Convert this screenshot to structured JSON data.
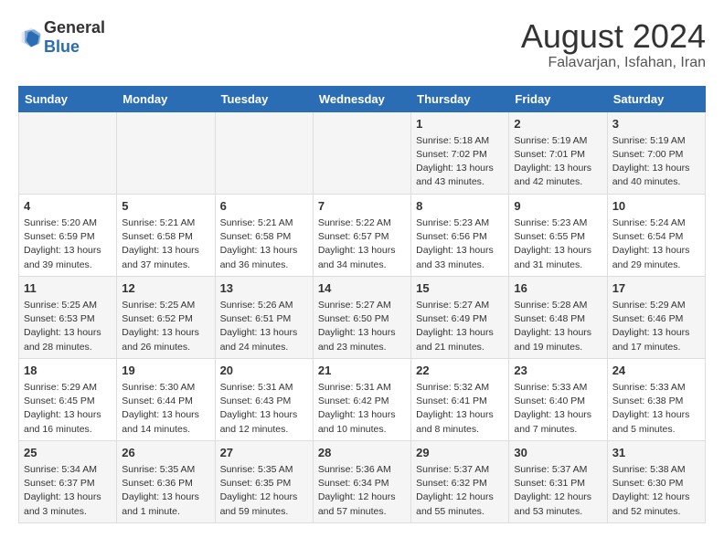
{
  "header": {
    "logo_general": "General",
    "logo_blue": "Blue",
    "title": "August 2024",
    "subtitle": "Falavarjan, Isfahan, Iran"
  },
  "weekdays": [
    "Sunday",
    "Monday",
    "Tuesday",
    "Wednesday",
    "Thursday",
    "Friday",
    "Saturday"
  ],
  "weeks": [
    [
      {
        "day": "",
        "info": ""
      },
      {
        "day": "",
        "info": ""
      },
      {
        "day": "",
        "info": ""
      },
      {
        "day": "",
        "info": ""
      },
      {
        "day": "1",
        "info": "Sunrise: 5:18 AM\nSunset: 7:02 PM\nDaylight: 13 hours\nand 43 minutes."
      },
      {
        "day": "2",
        "info": "Sunrise: 5:19 AM\nSunset: 7:01 PM\nDaylight: 13 hours\nand 42 minutes."
      },
      {
        "day": "3",
        "info": "Sunrise: 5:19 AM\nSunset: 7:00 PM\nDaylight: 13 hours\nand 40 minutes."
      }
    ],
    [
      {
        "day": "4",
        "info": "Sunrise: 5:20 AM\nSunset: 6:59 PM\nDaylight: 13 hours\nand 39 minutes."
      },
      {
        "day": "5",
        "info": "Sunrise: 5:21 AM\nSunset: 6:58 PM\nDaylight: 13 hours\nand 37 minutes."
      },
      {
        "day": "6",
        "info": "Sunrise: 5:21 AM\nSunset: 6:58 PM\nDaylight: 13 hours\nand 36 minutes."
      },
      {
        "day": "7",
        "info": "Sunrise: 5:22 AM\nSunset: 6:57 PM\nDaylight: 13 hours\nand 34 minutes."
      },
      {
        "day": "8",
        "info": "Sunrise: 5:23 AM\nSunset: 6:56 PM\nDaylight: 13 hours\nand 33 minutes."
      },
      {
        "day": "9",
        "info": "Sunrise: 5:23 AM\nSunset: 6:55 PM\nDaylight: 13 hours\nand 31 minutes."
      },
      {
        "day": "10",
        "info": "Sunrise: 5:24 AM\nSunset: 6:54 PM\nDaylight: 13 hours\nand 29 minutes."
      }
    ],
    [
      {
        "day": "11",
        "info": "Sunrise: 5:25 AM\nSunset: 6:53 PM\nDaylight: 13 hours\nand 28 minutes."
      },
      {
        "day": "12",
        "info": "Sunrise: 5:25 AM\nSunset: 6:52 PM\nDaylight: 13 hours\nand 26 minutes."
      },
      {
        "day": "13",
        "info": "Sunrise: 5:26 AM\nSunset: 6:51 PM\nDaylight: 13 hours\nand 24 minutes."
      },
      {
        "day": "14",
        "info": "Sunrise: 5:27 AM\nSunset: 6:50 PM\nDaylight: 13 hours\nand 23 minutes."
      },
      {
        "day": "15",
        "info": "Sunrise: 5:27 AM\nSunset: 6:49 PM\nDaylight: 13 hours\nand 21 minutes."
      },
      {
        "day": "16",
        "info": "Sunrise: 5:28 AM\nSunset: 6:48 PM\nDaylight: 13 hours\nand 19 minutes."
      },
      {
        "day": "17",
        "info": "Sunrise: 5:29 AM\nSunset: 6:46 PM\nDaylight: 13 hours\nand 17 minutes."
      }
    ],
    [
      {
        "day": "18",
        "info": "Sunrise: 5:29 AM\nSunset: 6:45 PM\nDaylight: 13 hours\nand 16 minutes."
      },
      {
        "day": "19",
        "info": "Sunrise: 5:30 AM\nSunset: 6:44 PM\nDaylight: 13 hours\nand 14 minutes."
      },
      {
        "day": "20",
        "info": "Sunrise: 5:31 AM\nSunset: 6:43 PM\nDaylight: 13 hours\nand 12 minutes."
      },
      {
        "day": "21",
        "info": "Sunrise: 5:31 AM\nSunset: 6:42 PM\nDaylight: 13 hours\nand 10 minutes."
      },
      {
        "day": "22",
        "info": "Sunrise: 5:32 AM\nSunset: 6:41 PM\nDaylight: 13 hours\nand 8 minutes."
      },
      {
        "day": "23",
        "info": "Sunrise: 5:33 AM\nSunset: 6:40 PM\nDaylight: 13 hours\nand 7 minutes."
      },
      {
        "day": "24",
        "info": "Sunrise: 5:33 AM\nSunset: 6:38 PM\nDaylight: 13 hours\nand 5 minutes."
      }
    ],
    [
      {
        "day": "25",
        "info": "Sunrise: 5:34 AM\nSunset: 6:37 PM\nDaylight: 13 hours\nand 3 minutes."
      },
      {
        "day": "26",
        "info": "Sunrise: 5:35 AM\nSunset: 6:36 PM\nDaylight: 13 hours\nand 1 minute."
      },
      {
        "day": "27",
        "info": "Sunrise: 5:35 AM\nSunset: 6:35 PM\nDaylight: 12 hours\nand 59 minutes."
      },
      {
        "day": "28",
        "info": "Sunrise: 5:36 AM\nSunset: 6:34 PM\nDaylight: 12 hours\nand 57 minutes."
      },
      {
        "day": "29",
        "info": "Sunrise: 5:37 AM\nSunset: 6:32 PM\nDaylight: 12 hours\nand 55 minutes."
      },
      {
        "day": "30",
        "info": "Sunrise: 5:37 AM\nSunset: 6:31 PM\nDaylight: 12 hours\nand 53 minutes."
      },
      {
        "day": "31",
        "info": "Sunrise: 5:38 AM\nSunset: 6:30 PM\nDaylight: 12 hours\nand 52 minutes."
      }
    ]
  ]
}
